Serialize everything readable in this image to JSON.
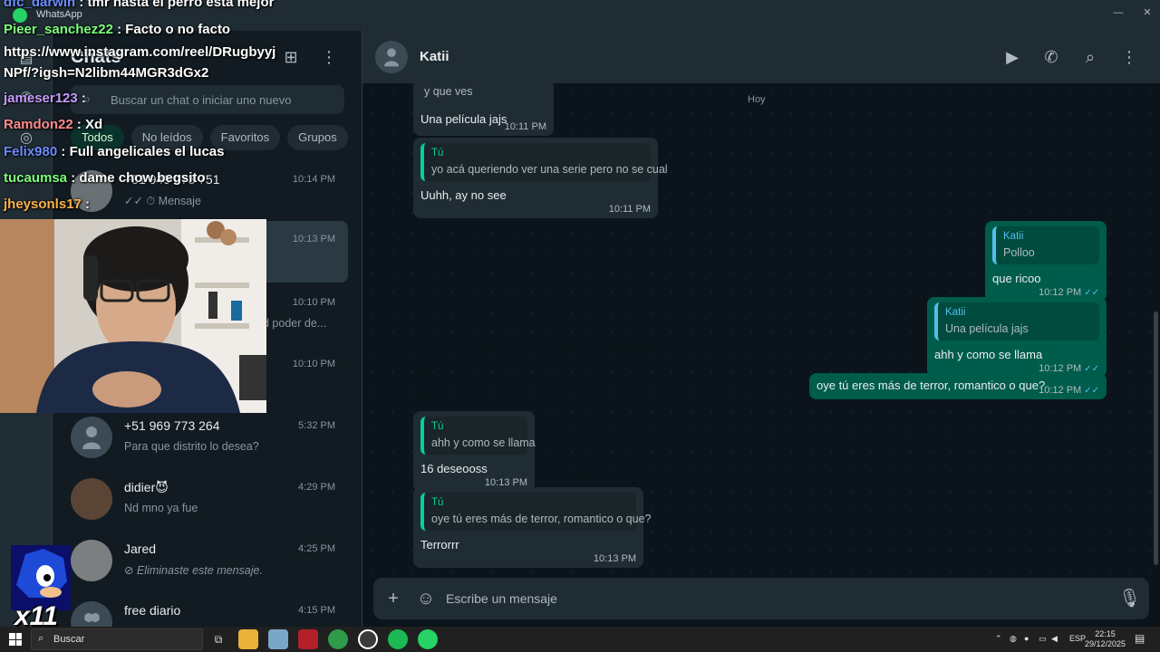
{
  "window": {
    "title": "WhatsApp",
    "controls": {
      "minimize": "—",
      "maximize": "▢",
      "close": "✕"
    }
  },
  "sidebar": {
    "title": "Chats",
    "search_placeholder": "Buscar un chat o iniciar uno nuevo",
    "filters": [
      "Todos",
      "No leídos",
      "Favoritos",
      "Grupos"
    ],
    "chats": [
      {
        "name": "+51 949 073 751",
        "time": "10:14 PM",
        "preview": "Mensaje",
        "preview_icons": "✓✓ ⏱"
      },
      {
        "name": "",
        "time": "10:13 PM",
        "preview": ""
      },
      {
        "name": "",
        "time": "10:10 PM",
        "preview": "d poder de..."
      },
      {
        "name": "",
        "time": "10:10 PM",
        "preview": ""
      },
      {
        "name": "+51 969 773 264",
        "time": "5:32 PM",
        "preview": "Para que distrito lo desea?"
      },
      {
        "name": "didier😈",
        "time": "4:29 PM",
        "preview": "Nd mno ya fue"
      },
      {
        "name": "Jared",
        "time": "4:25 PM",
        "preview": "Eliminaste este mensaje.",
        "preview_icons": "⊘"
      },
      {
        "name": "free diario",
        "time": "4:15 PM",
        "preview": ""
      }
    ]
  },
  "conversation": {
    "contact_name": "Katii",
    "date_chip": "Hoy",
    "messages": [
      {
        "dir": "in",
        "text": "Una película jajs",
        "time": "10:11 PM",
        "quote_text": "y que ves"
      },
      {
        "dir": "in",
        "text": "Uuhh, ay no see",
        "time": "10:11 PM",
        "quote_author": "Tú",
        "quote_text": "yo acá queriendo ver una serie pero no se cual"
      },
      {
        "dir": "out",
        "text": "que ricoo",
        "time": "10:12 PM",
        "quote_author": "Katii",
        "quote_text": "Polloo"
      },
      {
        "dir": "out",
        "text": "ahh y como se llama",
        "time": "10:12 PM",
        "quote_author": "Katii",
        "quote_text": "Una película jajs"
      },
      {
        "dir": "out",
        "text": "oye tú eres más de terror, romantico o que?",
        "time": "10:12 PM"
      },
      {
        "dir": "in",
        "text": "16 deseooss",
        "time": "10:13 PM",
        "quote_author": "Tú",
        "quote_text": "ahh y como se llama"
      },
      {
        "dir": "in",
        "text": "Terrorrr",
        "time": "10:13 PM",
        "quote_author": "Tú",
        "quote_text": "oye tú eres más de terror, romantico o que?"
      }
    ],
    "composer_placeholder": "Escribe un mensaje"
  },
  "stream_chat": [
    {
      "user": "dfc_darwin",
      "color": "#6b8cff",
      "text": "tmr hasta el perro esta mejor"
    },
    {
      "user": "Pieer_sanchez22",
      "color": "#7dff7d",
      "text": "Facto o no facto"
    },
    {
      "user": "",
      "color": "#ffffff",
      "text": "https://www.instagram.com/reel/DRugbyyj"
    },
    {
      "user": "",
      "color": "#ffffff",
      "text": "NPf/?igsh=N2libm44MGR3dGx2"
    },
    {
      "user": "jameser123",
      "color": "#c89bff",
      "text": ""
    },
    {
      "user": "Ramdon22",
      "color": "#ff8c8c",
      "text": "Xd"
    },
    {
      "user": "Felix980",
      "color": "#6b8cff",
      "text": "Full angelicales el lucas"
    },
    {
      "user": "tucaumsa",
      "color": "#7dff7d",
      "text": "dame chow begsito"
    },
    {
      "user": "jheysonls17",
      "color": "#ffb347",
      "text": ""
    }
  ],
  "badge": {
    "text": "x11"
  },
  "taskbar": {
    "search_label": "Buscar",
    "lang": "ESP",
    "time": "22:15",
    "date": "29/12/2025"
  },
  "colors": {
    "accent": "#00a884",
    "out_bubble": "#005c4b",
    "in_bubble": "#202c33",
    "bg": "#0b141a"
  }
}
